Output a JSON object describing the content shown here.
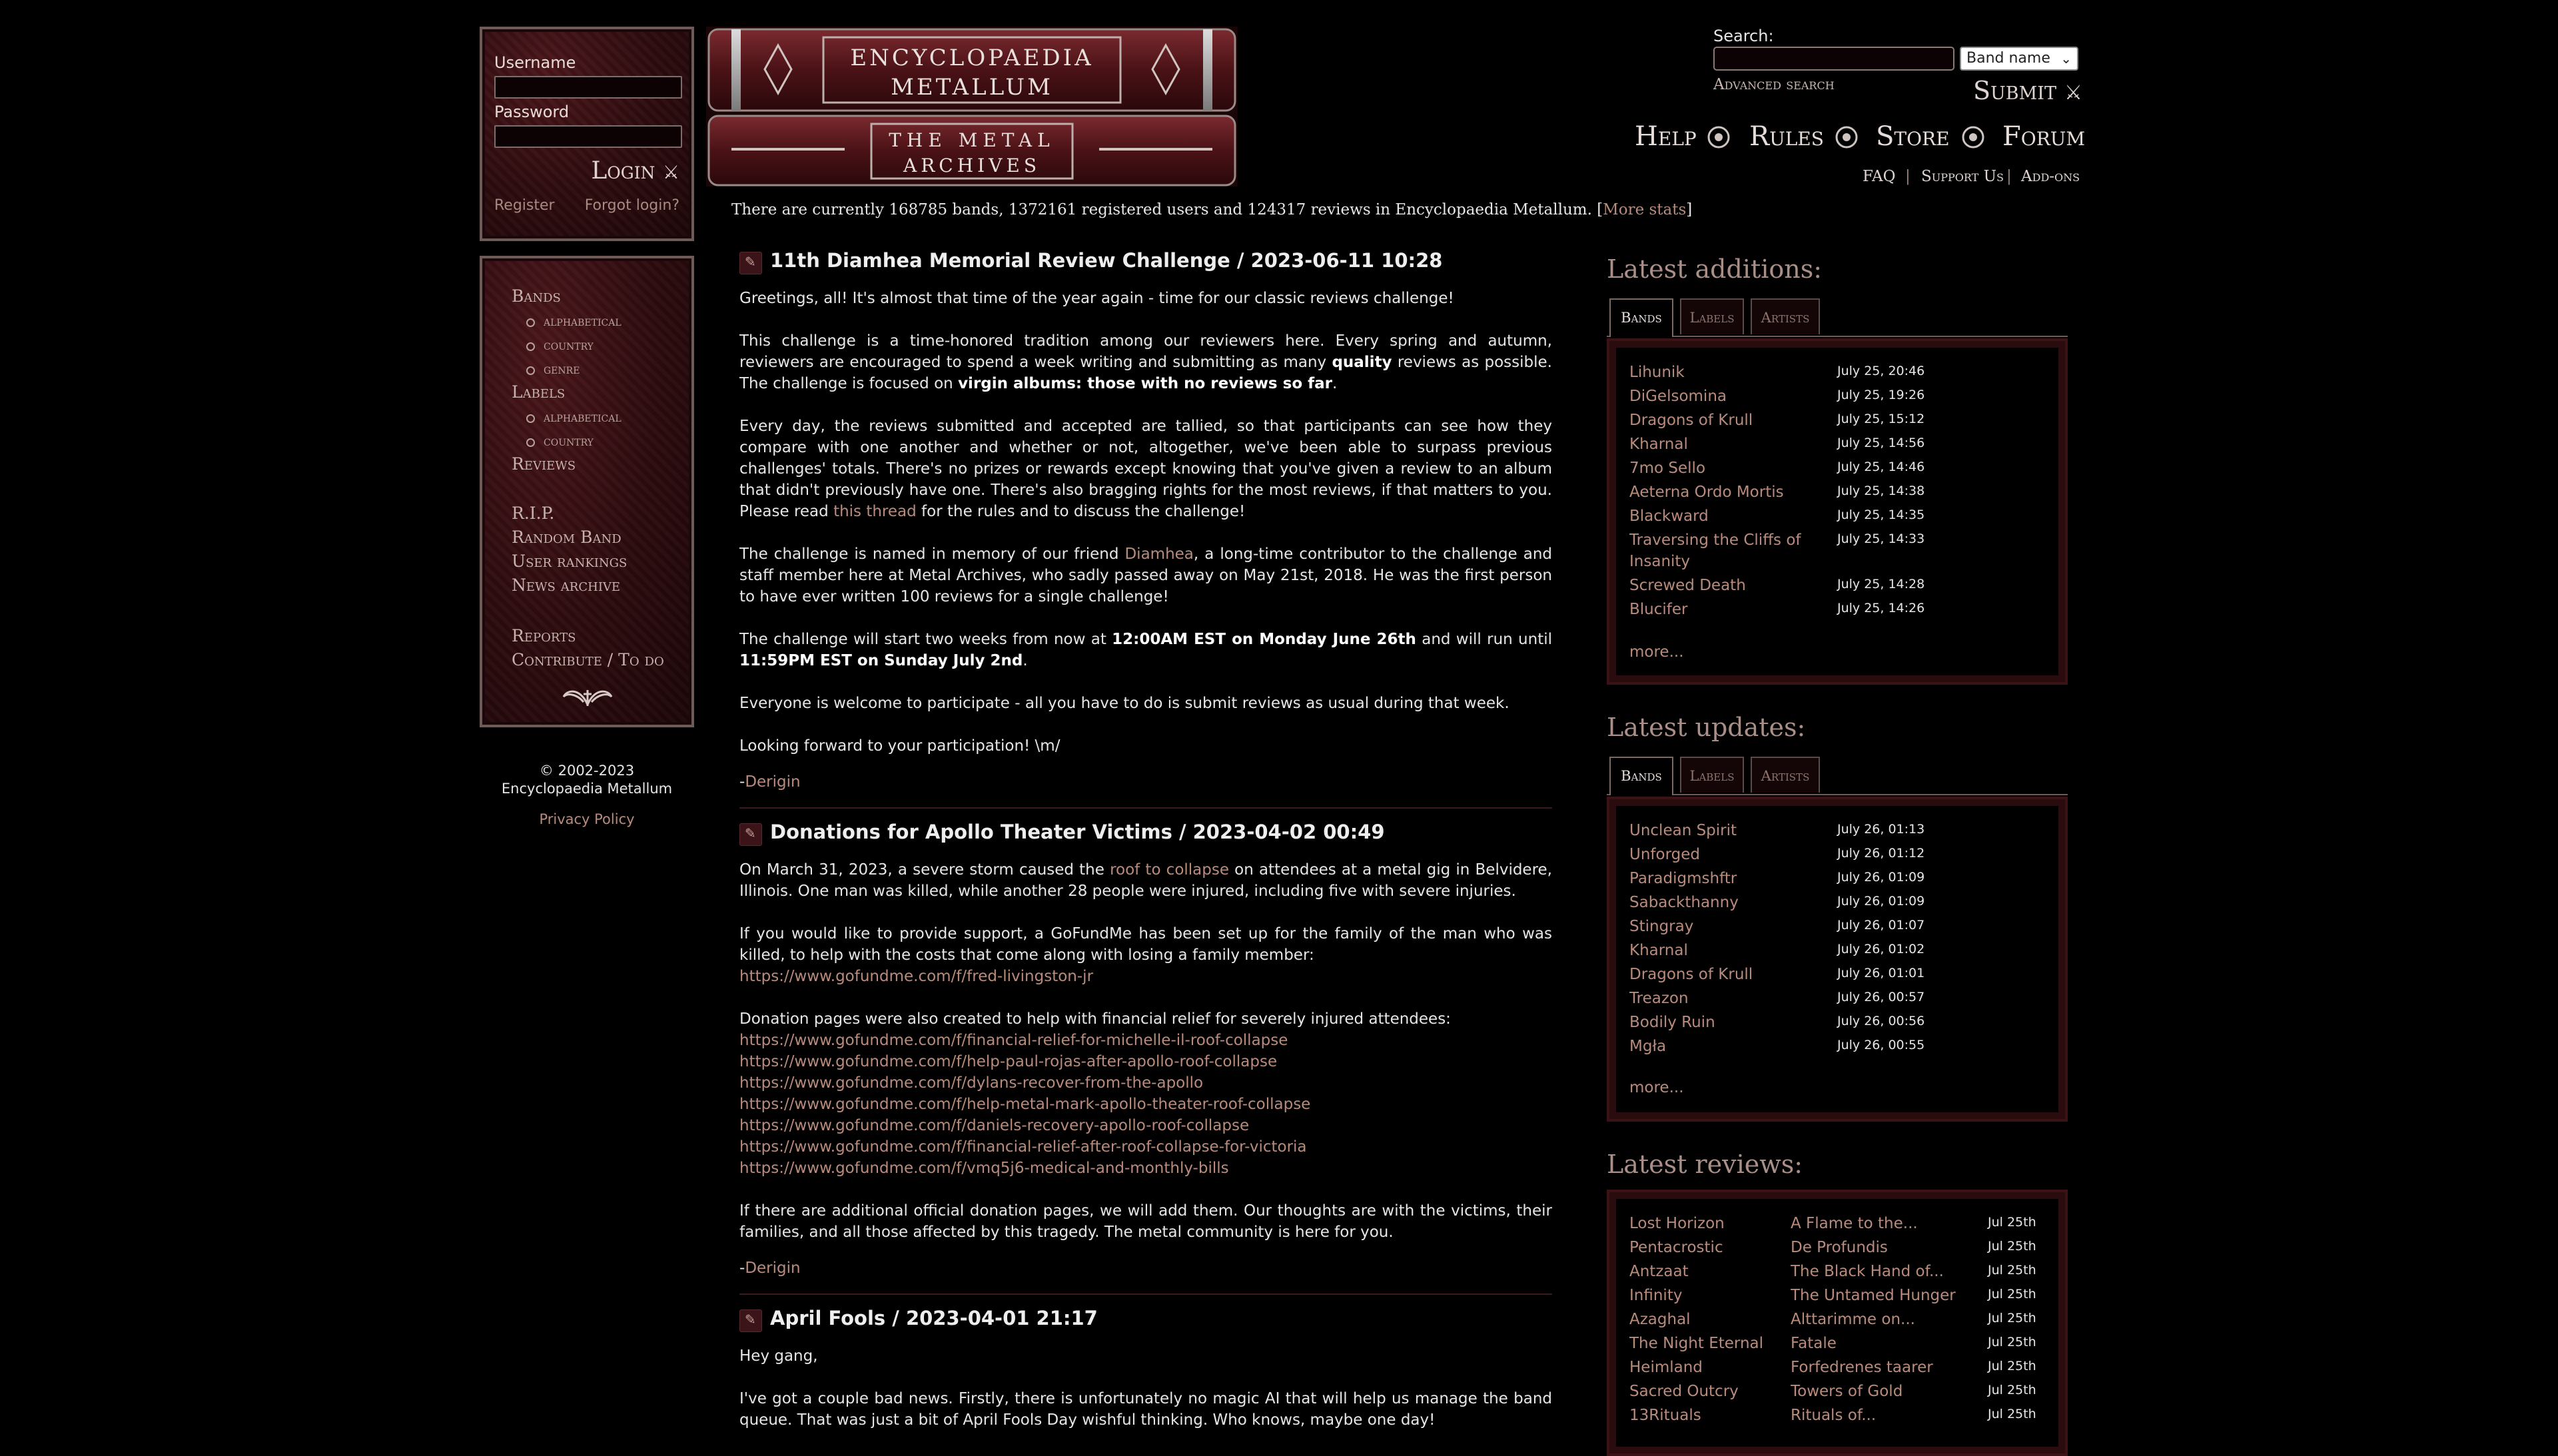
{
  "login": {
    "username_label": "Username",
    "password_label": "Password",
    "login_button": "Login",
    "register": "Register",
    "forgot": "Forgot login?"
  },
  "nav": {
    "bands": "Bands",
    "bands_sub": [
      "alphabetical",
      "country",
      "genre"
    ],
    "labels": "Labels",
    "labels_sub": [
      "alphabetical",
      "country"
    ],
    "reviews": "Reviews",
    "rip": "R.I.P.",
    "random_band": "Random Band",
    "user_rankings": "User rankings",
    "news_archive": "News archive",
    "reports": "Reports",
    "contribute": "Contribute / To do"
  },
  "footer": {
    "copyright_line1": "© 2002-2023",
    "copyright_line2": "Encyclopaedia Metallum",
    "privacy": "Privacy Policy"
  },
  "logo": {
    "line1": "ENCYCLOPAEDIA",
    "line2": "METALLUM",
    "line3": "THE METAL",
    "line4": "ARCHIVES"
  },
  "stats": {
    "text": "There are currently 168785 bands, 1372161 registered users and 124317 reviews in Encyclopaedia Metallum. [",
    "more": "More stats",
    "close": "]"
  },
  "search": {
    "label": "Search:",
    "value": "",
    "select_value": "Band name",
    "advanced": "Advanced search",
    "submit": "Submit"
  },
  "topnav": {
    "help": "Help",
    "rules": "Rules",
    "store": "Store",
    "forum": "Forum",
    "faq": "FAQ",
    "support": "Support Us",
    "addons": "Add-ons"
  },
  "news": {
    "n1_title": "11th Diamhea Memorial Review Challenge / 2023-06-11 10:28",
    "n1_p1": "Greetings, all! It's almost that time of the year again - time for our classic reviews challenge!",
    "n1_p2a": "This challenge is a time-honored tradition among our reviewers here. Every spring and autumn, reviewers are encouraged to spend a week writing and submitting as many ",
    "n1_p2b": "quality",
    "n1_p2c": " reviews as possible. The challenge is focused on ",
    "n1_p2d": "virgin albums: those with no reviews so far",
    "n1_p2e": ".",
    "n1_p3a": "Every day, the reviews submitted and accepted are tallied, so that participants can see how they compare with one another and whether or not, altogether, we've been able to surpass previous challenges' totals. There's no prizes or rewards except knowing that you've given a review to an album that didn't previously have one. There's also bragging rights for the most reviews, if that matters to you. Please read ",
    "n1_p3link": "this thread",
    "n1_p3b": " for the rules and to discuss the challenge!",
    "n1_p4a": "The challenge is named in memory of our friend ",
    "n1_p4link": "Diamhea",
    "n1_p4b": ", a long-time contributor to the challenge and staff member here at Metal Archives, who sadly passed away on May 21st, 2018. He was the first person to have ever written 100 reviews for a single challenge!",
    "n1_p5a": "The challenge will start two weeks from now at ",
    "n1_p5b": "12:00AM EST on Monday June 26th",
    "n1_p5c": " and will run until ",
    "n1_p5d": "11:59PM EST on Sunday July 2nd",
    "n1_p5e": ".",
    "n1_p6": "Everyone is welcome to participate - all you have to do is submit reviews as usual during that week.",
    "n1_p7": "Looking forward to your participation! \\m/",
    "n1_sig_dash": "-",
    "n1_sig": "Derigin",
    "n2_title": "Donations for Apollo Theater Victims / 2023-04-02 00:49",
    "n2_p1a": "On March 31, 2023, a severe storm caused the ",
    "n2_p1link": "roof to collapse",
    "n2_p1b": " on attendees at a metal gig in Belvidere, Illinois. One man was killed, while another 28 people were injured, including five with severe injuries.",
    "n2_p2": "If you would like to provide support, a GoFundMe has been set up for the family of the man who was killed, to help with the costs that come along with losing a family member:",
    "n2_link0": "https://www.gofundme.com/f/fred-livingston-jr",
    "n2_p3": "Donation pages were also created to help with financial relief for severely injured attendees:",
    "n2_links": [
      "https://www.gofundme.com/f/financial-relief-for-michelle-il-roof-collapse",
      "https://www.gofundme.com/f/help-paul-rojas-after-apollo-roof-collapse",
      "https://www.gofundme.com/f/dylans-recover-from-the-apollo",
      "https://www.gofundme.com/f/help-metal-mark-apollo-theater-roof-collapse",
      "https://www.gofundme.com/f/daniels-recovery-apollo-roof-collapse",
      "https://www.gofundme.com/f/financial-relief-after-roof-collapse-for-victoria",
      "https://www.gofundme.com/f/vmq5j6-medical-and-monthly-bills"
    ],
    "n2_p4": "If there are additional official donation pages, we will add them. Our thoughts are with the victims, their families, and all those affected by this tragedy. The metal community is here for you.",
    "n2_sig_dash": "-",
    "n2_sig": "Derigin",
    "n3_title": "April Fools / 2023-04-01 21:17",
    "n3_p1": "Hey gang,",
    "n3_p2": "I've got a couple bad news. Firstly, there is unfortunately no magic AI that will help us manage the band queue. That was just a bit of April Fools Day wishful thinking. Who knows, maybe one day!"
  },
  "sidebar": {
    "additions_title": "Latest additions:",
    "updates_title": "Latest updates:",
    "reviews_title": "Latest reviews:",
    "tab_bands": "Bands",
    "tab_labels": "Labels",
    "tab_artists": "Artists",
    "more": "more...",
    "additions": [
      {
        "name": "Lihunik",
        "date": "July 25, 20:46"
      },
      {
        "name": "DiGelsomina",
        "date": "July 25, 19:26"
      },
      {
        "name": "Dragons of Krull",
        "date": "July 25, 15:12"
      },
      {
        "name": "Kharnal",
        "date": "July 25, 14:56"
      },
      {
        "name": "7mo Sello",
        "date": "July 25, 14:46"
      },
      {
        "name": "Aeterna Ordo Mortis",
        "date": "July 25, 14:38"
      },
      {
        "name": "Blackward",
        "date": "July 25, 14:35"
      },
      {
        "name": "Traversing the Cliffs of",
        "name2": "Insanity",
        "date": "July 25, 14:33"
      },
      {
        "name": "Screwed Death",
        "date": "July 25, 14:28"
      },
      {
        "name": "Blucifer",
        "date": "July 25, 14:26"
      }
    ],
    "updates": [
      {
        "name": "Unclean Spirit",
        "date": "July 26, 01:13"
      },
      {
        "name": "Unforged",
        "date": "July 26, 01:12"
      },
      {
        "name": "Paradigmshftr",
        "date": "July 26, 01:09"
      },
      {
        "name": "Sabackthanny",
        "date": "July 26, 01:09"
      },
      {
        "name": "Stingray",
        "date": "July 26, 01:07"
      },
      {
        "name": "Kharnal",
        "date": "July 26, 01:02"
      },
      {
        "name": "Dragons of Krull",
        "date": "July 26, 01:01"
      },
      {
        "name": "Treazon",
        "date": "July 26, 00:57"
      },
      {
        "name": "Bodily Ruin",
        "date": "July 26, 00:56"
      },
      {
        "name": "Mgła",
        "date": "July 26, 00:55"
      }
    ],
    "reviews": [
      {
        "band": "Lost Horizon",
        "album": "A Flame to the...",
        "date": "Jul 25th"
      },
      {
        "band": "Pentacrostic",
        "album": "De Profundis",
        "date": "Jul 25th"
      },
      {
        "band": "Antzaat",
        "album": "The Black Hand of...",
        "date": "Jul 25th"
      },
      {
        "band": "Infinity",
        "album": "The Untamed Hunger",
        "date": "Jul 25th"
      },
      {
        "band": "Azaghal",
        "album": "Alttarimme on...",
        "date": "Jul 25th"
      },
      {
        "band": "The Night Eternal",
        "album": "Fatale",
        "date": "Jul 25th"
      },
      {
        "band": "Heimland",
        "album": "Forfedrenes taarer",
        "date": "Jul 25th"
      },
      {
        "band": "Sacred Outcry",
        "album": "Towers of Gold",
        "date": "Jul 25th"
      },
      {
        "band": "13Rituals",
        "album": "Rituals of...",
        "date": "Jul 25th"
      }
    ]
  }
}
